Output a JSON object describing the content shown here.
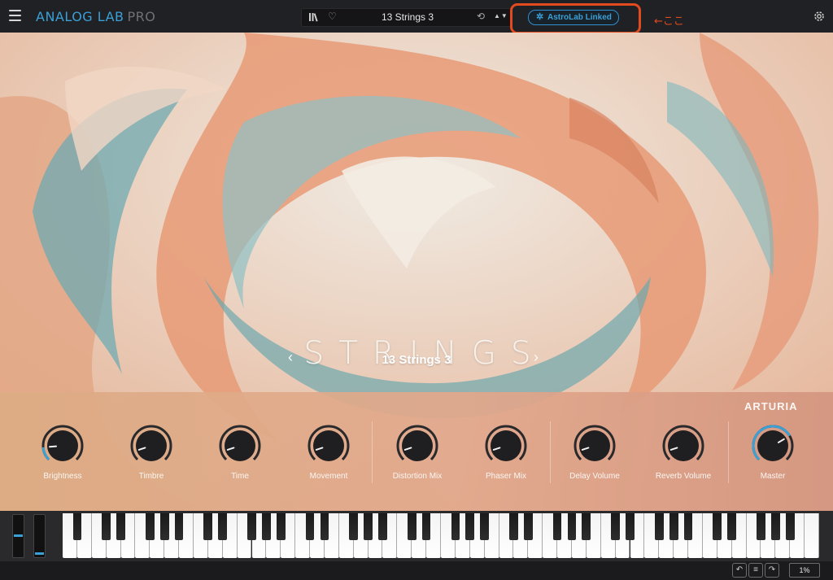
{
  "header": {
    "brand": "ANALOG LAB",
    "brand_suffix": "PRO",
    "preset_name": "13 Strings 3",
    "astrolab_label": "AstroLab Linked",
    "note": "←ここ",
    "arrows": "▲▼"
  },
  "main": {
    "category": "STRINGS",
    "preset_name": "13 Strings 3",
    "prev": "‹",
    "next": "›"
  },
  "controls": {
    "brand": "ARTURIA",
    "knobs": [
      {
        "label": "Brightness",
        "value": 0.15,
        "active": true
      },
      {
        "label": "Timbre",
        "value": 0.1,
        "active": false
      },
      {
        "label": "Time",
        "value": 0.1,
        "active": false
      },
      {
        "label": "Movement",
        "value": 0.1,
        "active": false
      },
      {
        "label": "Distortion Mix",
        "value": 0.1,
        "active": false
      },
      {
        "label": "Phaser Mix",
        "value": 0.1,
        "active": false
      },
      {
        "label": "Delay Volume",
        "value": 0.1,
        "active": false
      },
      {
        "label": "Reverb Volume",
        "value": 0.1,
        "active": false
      },
      {
        "label": "Master",
        "value": 0.72,
        "active": true
      }
    ]
  },
  "footer": {
    "cpu": "1%",
    "undo": "↶",
    "history": "≡",
    "redo": "↷"
  },
  "colors": {
    "accent": "#3aa0d6",
    "highlight": "#e24a1f"
  }
}
